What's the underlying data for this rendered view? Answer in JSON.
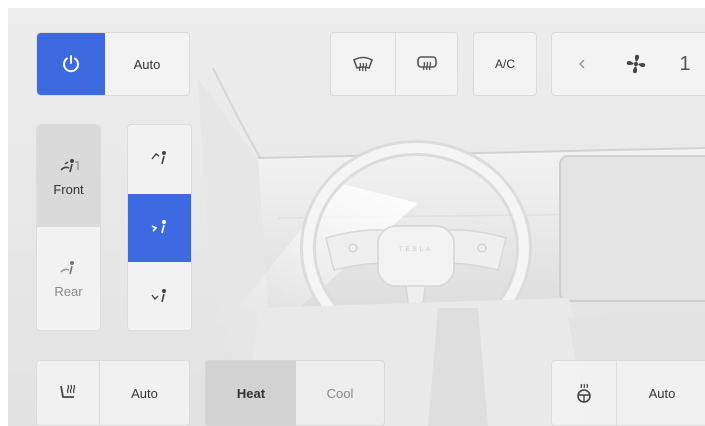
{
  "climate": {
    "power": {
      "icon": "power-icon",
      "on": true
    },
    "auto_label": "Auto",
    "defrost": {
      "front_icon": "front-defrost-icon",
      "rear_icon": "rear-defrost-icon"
    },
    "ac_label": "A/C",
    "fan": {
      "prev_icon": "chevron-left-icon",
      "icon": "fan-icon",
      "speed": "1"
    }
  },
  "zone": {
    "front_label": "Front",
    "rear_label": "Rear",
    "selected": "Front"
  },
  "airflow": {
    "modes": [
      "windshield",
      "face",
      "feet"
    ],
    "selected": "face"
  },
  "bottom": {
    "seat_heat_icon": "seat-heater-icon",
    "seat_auto_label": "Auto",
    "heat_label": "Heat",
    "cool_label": "Cool",
    "selected": "Heat",
    "wheel_heat_icon": "steering-wheel-heater-icon",
    "wheel_auto_label": "Auto"
  },
  "colors": {
    "accent": "#3e6ae1",
    "background": "#ececec",
    "panel": "#f4f4f4",
    "selected_gray": "#d2d2d2"
  }
}
